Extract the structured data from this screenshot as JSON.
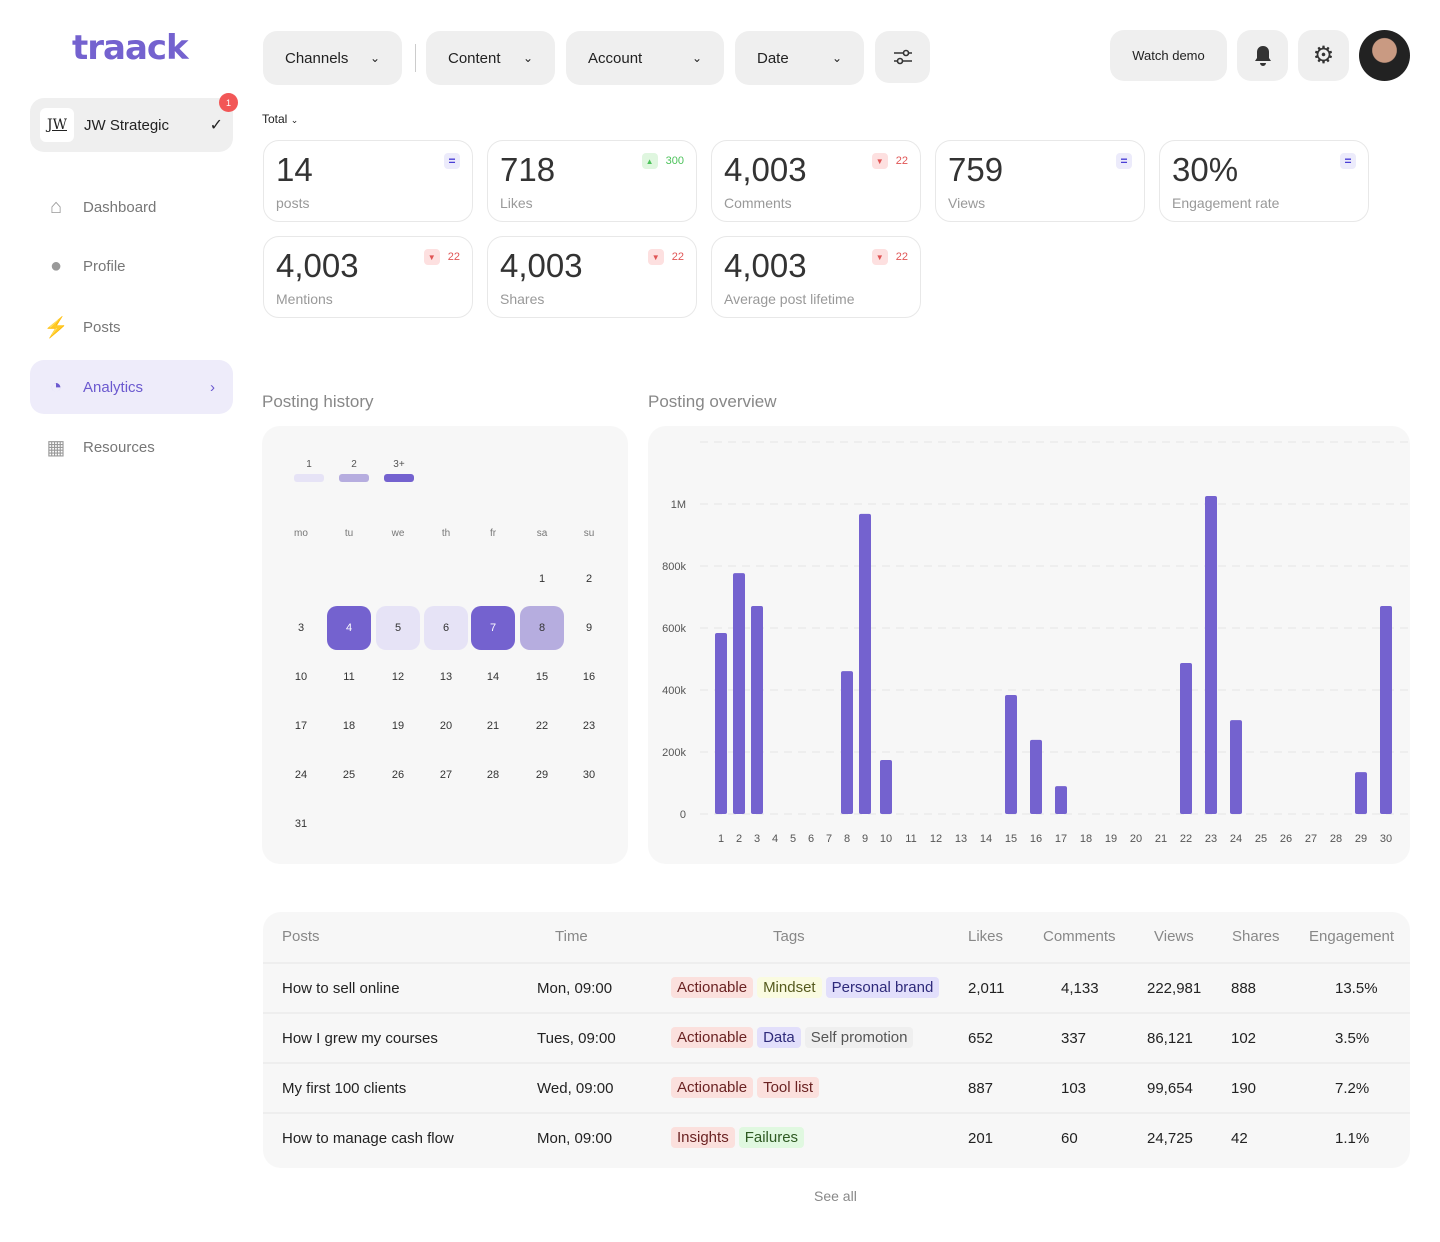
{
  "logo": "traack",
  "account": {
    "initials": "JW",
    "name": "JW Strategic",
    "badge": "1"
  },
  "nav": [
    {
      "label": "Dashboard",
      "icon": "home-icon"
    },
    {
      "label": "Profile",
      "icon": "user-icon"
    },
    {
      "label": "Posts",
      "icon": "bolt-icon"
    },
    {
      "label": "Analytics",
      "icon": "pie-chart-icon",
      "active": true
    },
    {
      "label": "Resources",
      "icon": "grid-icon"
    }
  ],
  "filters": [
    "Channels",
    "Content",
    "Account",
    "Date"
  ],
  "header": {
    "watch_demo": "Watch demo"
  },
  "total_label": "Total",
  "metrics": [
    {
      "value": "14",
      "label": "posts",
      "trend": "neutral",
      "delta": ""
    },
    {
      "value": "718",
      "label": "Likes",
      "trend": "up",
      "delta": "300"
    },
    {
      "value": "4,003",
      "label": "Comments",
      "trend": "down",
      "delta": "22"
    },
    {
      "value": "759",
      "label": "Views",
      "trend": "neutral",
      "delta": ""
    },
    {
      "value": "30%",
      "label": "Engagement rate",
      "trend": "neutral",
      "delta": ""
    },
    {
      "value": "4,003",
      "label": "Mentions",
      "trend": "down",
      "delta": "22"
    },
    {
      "value": "4,003",
      "label": "Shares",
      "trend": "down",
      "delta": "22"
    },
    {
      "value": "4,003",
      "label": "Average post lifetime",
      "trend": "down",
      "delta": "22"
    }
  ],
  "history": {
    "title": "Posting history",
    "legend": [
      "1",
      "2",
      "3+"
    ],
    "weekdays": [
      "mo",
      "tu",
      "we",
      "th",
      "fr",
      "sa",
      "su"
    ],
    "first_weekday": 5,
    "days": 31,
    "levels": {
      "4": 3,
      "5": 1,
      "6": 1,
      "7": 3,
      "8": 2
    }
  },
  "colors": {
    "accent": "#7462cf",
    "l1": "#e6e3f6",
    "l2": "#b6addf",
    "l3": "#7462cf"
  },
  "chart_data": {
    "type": "bar",
    "title": "Posting overview",
    "categories": [
      "1",
      "2",
      "3",
      "4",
      "5",
      "6",
      "7",
      "8",
      "9",
      "10",
      "11",
      "12",
      "13",
      "14",
      "15",
      "16",
      "17",
      "18",
      "19",
      "20",
      "21",
      "22",
      "23",
      "24",
      "25",
      "26",
      "27",
      "28",
      "29",
      "30"
    ],
    "values": [
      584000,
      777000,
      671000,
      0,
      0,
      0,
      0,
      461000,
      968000,
      174000,
      0,
      0,
      0,
      0,
      384000,
      239000,
      90000,
      0,
      0,
      0,
      0,
      487000,
      1026000,
      303000,
      0,
      0,
      0,
      0,
      135000,
      671000
    ],
    "yticks": [
      "0",
      "200k",
      "400k",
      "600k",
      "800k",
      "1M"
    ],
    "ylim": [
      0,
      1100000
    ],
    "xlabel": "",
    "ylabel": ""
  },
  "table": {
    "headers": [
      "Posts",
      "Time",
      "Tags",
      "Likes",
      "Comments",
      "Views",
      "Shares",
      "Engagement"
    ],
    "rows": [
      {
        "post": "How to sell online",
        "time": "Mon, 09:00",
        "tags": [
          {
            "t": "Actionable",
            "c": "red"
          },
          {
            "t": "Mindset",
            "c": "yellow"
          },
          {
            "t": "Personal brand",
            "c": "purple"
          }
        ],
        "likes": "2,011",
        "comments": "4,133",
        "views": "222,981",
        "shares": "888",
        "eng": "13.5%"
      },
      {
        "post": "How I grew my courses",
        "time": "Tues, 09:00",
        "tags": [
          {
            "t": "Actionable",
            "c": "red"
          },
          {
            "t": "Data",
            "c": "purple"
          },
          {
            "t": "Self promotion",
            "c": "gray"
          }
        ],
        "likes": "652",
        "comments": "337",
        "views": "86,121",
        "shares": "102",
        "eng": "3.5%"
      },
      {
        "post": "My first 100 clients",
        "time": "Wed, 09:00",
        "tags": [
          {
            "t": "Actionable",
            "c": "red"
          },
          {
            "t": "Tool list",
            "c": "red"
          }
        ],
        "likes": "887",
        "comments": "103",
        "views": "99,654",
        "shares": "190",
        "eng": "7.2%"
      },
      {
        "post": "How to manage cash flow",
        "time": "Mon, 09:00",
        "tags": [
          {
            "t": "Insights",
            "c": "red"
          },
          {
            "t": "Failures",
            "c": "green"
          }
        ],
        "likes": "201",
        "comments": "60",
        "views": "24,725",
        "shares": "42",
        "eng": "1.1%"
      }
    ],
    "see_all": "See all"
  }
}
